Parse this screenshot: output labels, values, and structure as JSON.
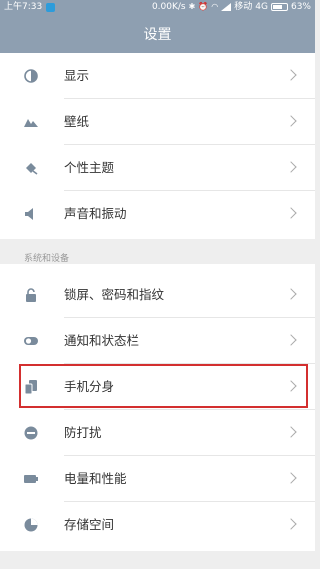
{
  "status_bar": {
    "time": "上午7:33",
    "network_speed": "0.00K/s",
    "carrier": "移动",
    "network_type": "4G",
    "battery": "63%"
  },
  "header": {
    "title": "设置"
  },
  "group1": {
    "items": [
      {
        "label": "显示",
        "icon": "display-icon"
      },
      {
        "label": "壁纸",
        "icon": "wallpaper-icon"
      },
      {
        "label": "个性主题",
        "icon": "theme-icon"
      },
      {
        "label": "声音和振动",
        "icon": "sound-icon"
      }
    ]
  },
  "group2": {
    "title": "系统和设备",
    "items": [
      {
        "label": "锁屏、密码和指纹",
        "icon": "lock-icon"
      },
      {
        "label": "通知和状态栏",
        "icon": "toggle-icon"
      },
      {
        "label": "手机分身",
        "icon": "second-space-icon"
      },
      {
        "label": "防打扰",
        "icon": "do-not-disturb-icon"
      },
      {
        "label": "电量和性能",
        "icon": "battery-icon"
      },
      {
        "label": "存储空间",
        "icon": "storage-icon"
      }
    ]
  },
  "colors": {
    "header_bg": "#8e9fb1",
    "icon": "#7a8b9c",
    "highlight": "#d32f2f"
  }
}
